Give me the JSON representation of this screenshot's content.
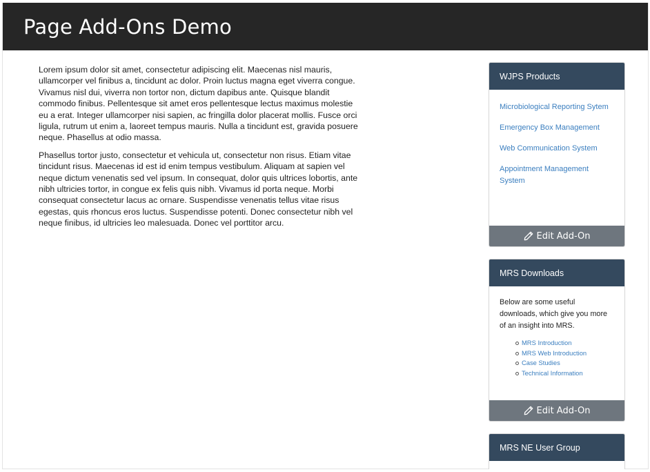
{
  "header": {
    "title": "Page Add-Ons Demo"
  },
  "main": {
    "paragraphs": [
      "Lorem ipsum dolor sit amet, consectetur adipiscing elit. Maecenas nisl mauris, ullamcorper vel finibus a, tincidunt ac dolor. Proin luctus magna eget viverra congue. Vivamus nisl dui, viverra non tortor non, dictum dapibus ante. Quisque blandit commodo finibus. Pellentesque sit amet eros pellentesque lectus maximus molestie eu a erat. Integer ullamcorper nisi sapien, ac fringilla dolor placerat mollis. Fusce orci ligula, rutrum ut enim a, laoreet tempus mauris. Nulla a tincidunt est, gravida posuere neque. Phasellus at odio massa.",
      "Phasellus tortor justo, consectetur et vehicula ut, consectetur non risus. Etiam vitae tincidunt risus. Maecenas id est id enim tempus vestibulum. Aliquam at sapien vel neque dictum venenatis sed vel ipsum. In consequat, dolor quis ultrices lobortis, ante nibh ultricies tortor, in congue ex felis quis nibh. Vivamus id porta neque. Morbi consequat consectetur lacus ac ornare. Suspendisse venenatis tellus vitae risus egestas, quis rhoncus eros luctus. Suspendisse potenti. Donec consectetur nibh vel neque finibus, id ultricies leo malesuada. Donec vel porttitor arcu."
    ]
  },
  "sidebar": {
    "products": {
      "title": "WJPS Products",
      "links": [
        "Microbiological Reporting Sytem",
        "Emergency Box Management",
        "Web Communication System",
        "Appointment Management System"
      ],
      "edit_label": "Edit Add-On"
    },
    "downloads": {
      "title": "MRS Downloads",
      "description": "Below are some useful downloads, which give you more of an insight into MRS.",
      "links": [
        "MRS Introduction",
        "MRS Web Introduction",
        "Case Studies",
        "Technical Information"
      ],
      "edit_label": "Edit Add-On"
    },
    "user_group": {
      "title": "MRS NE User Group"
    }
  },
  "icons": {
    "edit": "pencil-icon"
  },
  "colors": {
    "header_bg": "#262626",
    "panel_head_bg": "#34495e",
    "link": "#3a7ebf",
    "button_bg": "#6e767e"
  }
}
